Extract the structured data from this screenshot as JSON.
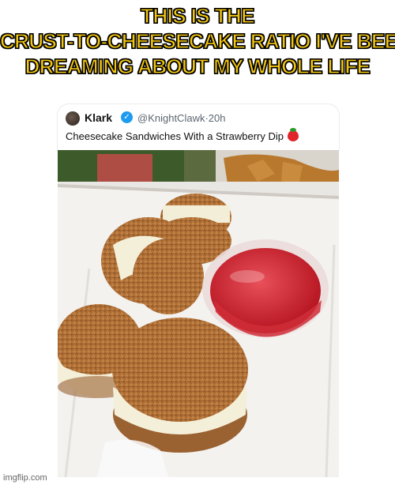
{
  "meme": {
    "caption_lines": [
      "THIS IS THE",
      "CRUST-TO-CHEESECAKE RATIO I'VE BEEN",
      "DREAMING ABOUT MY WHOLE LIFE"
    ]
  },
  "tweet": {
    "name": "Klark",
    "handle": "@KnightClawk",
    "time": "20h",
    "text": "Cheesecake Sandwiches With a Strawberry Dip",
    "emoji_icon": "strawberry-icon",
    "verified_icon": "verified-badge-icon"
  },
  "watermark": "imgflip.com"
}
